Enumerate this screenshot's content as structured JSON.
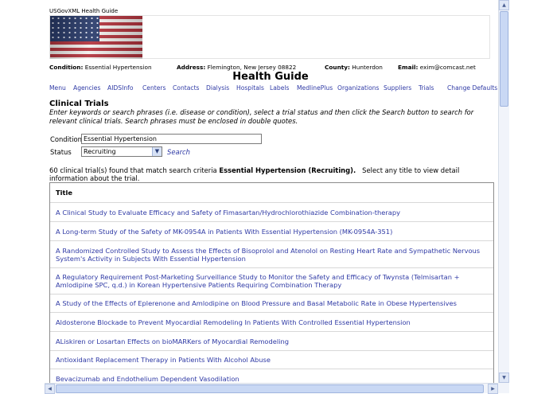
{
  "site_title": "USGovXML Health Guide",
  "header": {
    "condition_label": "Condition:",
    "condition_value": "Essential Hypertension",
    "address_label": "Address:",
    "address_value": "Flemington, New Jersey 08822",
    "county_label": "County:",
    "county_value": "Hunterdon",
    "email_label": "Email:",
    "email_value": "exim@comcast.net"
  },
  "page_heading": "Health Guide",
  "nav": [
    "Menu",
    "Agencies",
    "AIDSInfo",
    "Centers",
    "Contacts",
    "Dialysis",
    "Hospitals",
    "Labels",
    "MedlinePlus",
    "Organizations",
    "Suppliers",
    "Trials",
    "Change Defaults"
  ],
  "section_title": "Clinical Trials",
  "instructions": "Enter keywords or search phrases (i.e. disease or condition), select a trial status and then click the Search button to search for relevant clinical trials. Search phrases must be enclosed in double quotes.",
  "form": {
    "condition_label": "Condition",
    "condition_value": "Essential Hypertension",
    "status_label": "Status",
    "status_value": "Recruiting",
    "search_label": "Search"
  },
  "summary": {
    "prefix": "60 clinical trial(s) found that match search criteria",
    "criteria": "Essential Hypertension (Recruiting).",
    "suffix": "Select any title to view detail information about the trial."
  },
  "table": {
    "header": "Title",
    "rows": [
      "A Clinical Study to Evaluate Efficacy and Safety of Fimasartan/Hydrochlorothiazide Combination-therapy",
      "A Long-term Study of the Safety of MK-0954A in Patients With Essential Hypertension (MK-0954A-351)",
      "A Randomized Controlled Study to Assess the Effects of Bisoprolol and Atenolol on Resting Heart Rate and Sympathetic Nervous System's Activity in Subjects With Essential Hypertension",
      "A Regulatory Requirement Post-Marketing Surveillance Study to Monitor the Safety and Efficacy of Twynsta (Telmisartan + Amlodipine SPC, q.d.) in Korean Hypertensive Patients Requiring Combination Therapy",
      "A Study of the Effects of Eplerenone and Amlodipine on Blood Pressure and Basal Metabolic Rate in Obese Hypertensives",
      "Aldosterone Blockade to Prevent Myocardial Remodeling In Patients With Controlled Essential Hypertension",
      "ALiskiren or Losartan Effects on bioMARKers of Myocardial Remodeling",
      "Antioxidant Replacement Therapy in Patients With Alcohol Abuse",
      "Bevacizumab and Endothelium Dependent Vasodilation"
    ]
  },
  "icons": {
    "dropdown": "chevron-down-icon",
    "scroll_up": "arrow-up-icon",
    "scroll_down": "arrow-down-icon",
    "scroll_left": "arrow-left-icon",
    "scroll_right": "arrow-right-icon",
    "banner": "american-flag-icon"
  },
  "colors": {
    "link": "#2f3aa5",
    "scrollbar": "#c9d8f4"
  }
}
